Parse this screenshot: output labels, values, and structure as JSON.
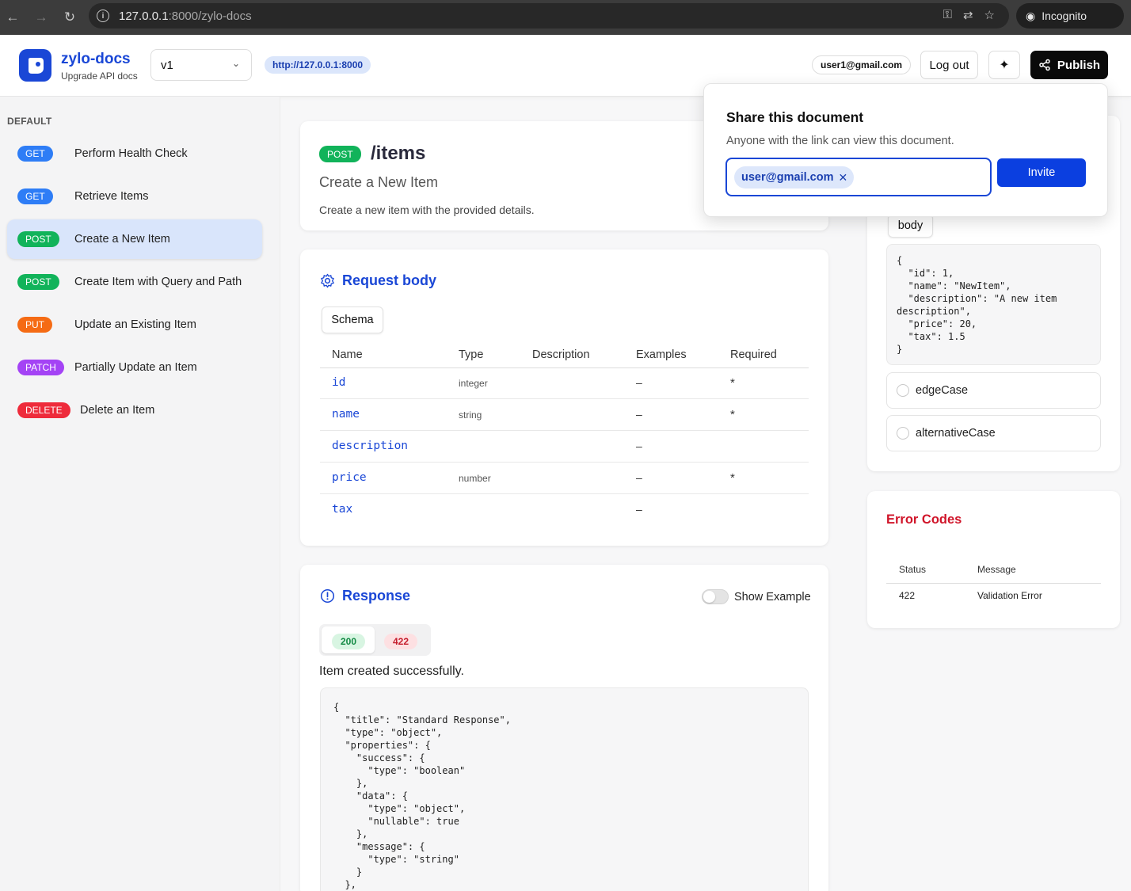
{
  "browser": {
    "url_host": "127.0.0.1",
    "url_rest": ":8000/zylo-docs",
    "incognito_label": "Incognito"
  },
  "header": {
    "brand_title": "zylo-docs",
    "brand_subtitle": "Upgrade API docs",
    "version_value": "v1",
    "base_url": "http://127.0.0.1:8000",
    "user_email": "user1@gmail.com",
    "logout_label": "Log out",
    "publish_label": "Publish"
  },
  "sidebar": {
    "heading": "DEFAULT",
    "items": [
      {
        "method": "GET",
        "label": "Perform Health Check"
      },
      {
        "method": "GET",
        "label": "Retrieve Items"
      },
      {
        "method": "POST",
        "label": "Create a New Item"
      },
      {
        "method": "POST",
        "label": "Create Item with Query and Path"
      },
      {
        "method": "PUT",
        "label": "Update an Existing Item"
      },
      {
        "method": "PATCH",
        "label": "Partially Update an Item"
      },
      {
        "method": "DELETE",
        "label": "Delete an Item"
      }
    ]
  },
  "endpoint": {
    "method": "POST",
    "path": "/items",
    "summary": "Create a New Item",
    "description": "Create a new item with the provided details."
  },
  "request_body": {
    "title": "Request body",
    "tab_label": "Schema",
    "columns": [
      "Name",
      "Type",
      "Description",
      "Examples",
      "Required"
    ],
    "rows": [
      {
        "name": "id",
        "type": "integer",
        "example": "–",
        "required": "*"
      },
      {
        "name": "name",
        "type": "string",
        "example": "–",
        "required": "*"
      },
      {
        "name": "description",
        "type": "",
        "example": "–",
        "required": ""
      },
      {
        "name": "price",
        "type": "number",
        "example": "–",
        "required": "*"
      },
      {
        "name": "tax",
        "type": "",
        "example": "–",
        "required": ""
      }
    ]
  },
  "response": {
    "title": "Response",
    "toggle_label": "Show Example",
    "status_tabs": [
      "200",
      "422"
    ],
    "description": "Item created successfully.",
    "code": "{\n  \"title\": \"Standard Response\",\n  \"type\": \"object\",\n  \"properties\": {\n    \"success\": {\n      \"type\": \"boolean\"\n    },\n    \"data\": {\n      \"type\": \"object\",\n      \"nullable\": true\n    },\n    \"message\": {\n      \"type\": \"string\"\n    }\n  },"
  },
  "request_example": {
    "tab_label": "body",
    "code": "{\n  \"id\": 1,\n  \"name\": \"NewItem\",\n  \"description\": \"A new item\ndescription\",\n  \"price\": 20,\n  \"tax\": 1.5\n}",
    "options": [
      "edgeCase",
      "alternativeCase"
    ]
  },
  "error_codes": {
    "title": "Error Codes",
    "columns": [
      "Status",
      "Message"
    ],
    "rows": [
      {
        "status": "422",
        "message": "Validation Error"
      }
    ]
  },
  "share": {
    "title": "Share this document",
    "subtitle": "Anyone with the link can view this document.",
    "chip_email": "user@gmail.com",
    "invite_label": "Invite"
  },
  "colors": {
    "accent": "#1a47d6",
    "get": "#2e7df6",
    "post": "#11b35a",
    "put": "#f56b14",
    "patch": "#a443f5",
    "delete": "#ee2b3b",
    "error": "#d0152a"
  },
  "icons": [
    "back-arrow-icon",
    "forward-arrow-icon",
    "reload-icon",
    "info-icon",
    "key-icon",
    "translate-icon",
    "star-icon",
    "incognito-icon",
    "chevron-down-icon",
    "magic-wand-icon",
    "share-icon",
    "gear-icon",
    "alert-circle-icon",
    "close-icon"
  ]
}
